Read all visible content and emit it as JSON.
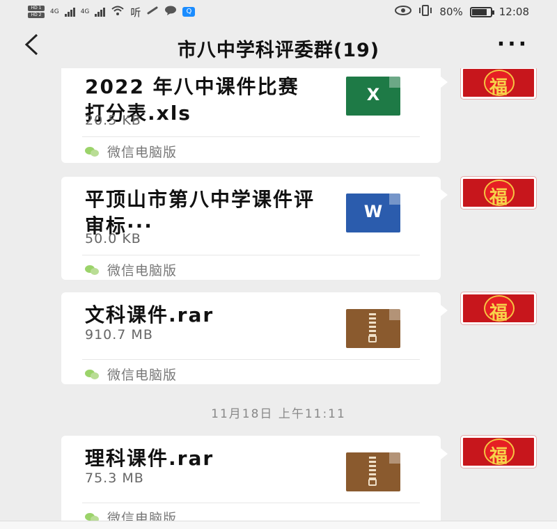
{
  "status_bar": {
    "sim1": "HD 1",
    "sim2": "HD 2",
    "signal1_label": "4G",
    "signal2_label": "4G",
    "hd_label": "听",
    "battery_percent": "80%",
    "battery_level": 0.8,
    "time": "12:08"
  },
  "header": {
    "back_symbol": "<",
    "title": "市八中学科评委群(19)",
    "more_symbol": "···"
  },
  "messages": [
    {
      "file_name": "2022 年八中课件比赛打分表.xls",
      "file_size": "20.5 KB",
      "source": "微信电脑版",
      "file_type": "xls",
      "icon_letter": "X",
      "icon_color": "#1e7a46"
    },
    {
      "file_name": "平顶山市第八中学课件评审标···",
      "file_size": "50.0 KB",
      "source": "微信电脑版",
      "file_type": "doc",
      "icon_letter": "W",
      "icon_color": "#2b5cad"
    },
    {
      "file_name": "文科课件.rar",
      "file_size": "910.7 MB",
      "source": "微信电脑版",
      "file_type": "rar",
      "icon_color": "#8a5a2e"
    },
    {
      "file_name": "理科课件.rar",
      "file_size": "75.3 MB",
      "source": "微信电脑版",
      "file_type": "rar",
      "icon_color": "#8a5a2e"
    }
  ],
  "timestamp": "11月18日 上午11:11",
  "avatar_text": "福"
}
